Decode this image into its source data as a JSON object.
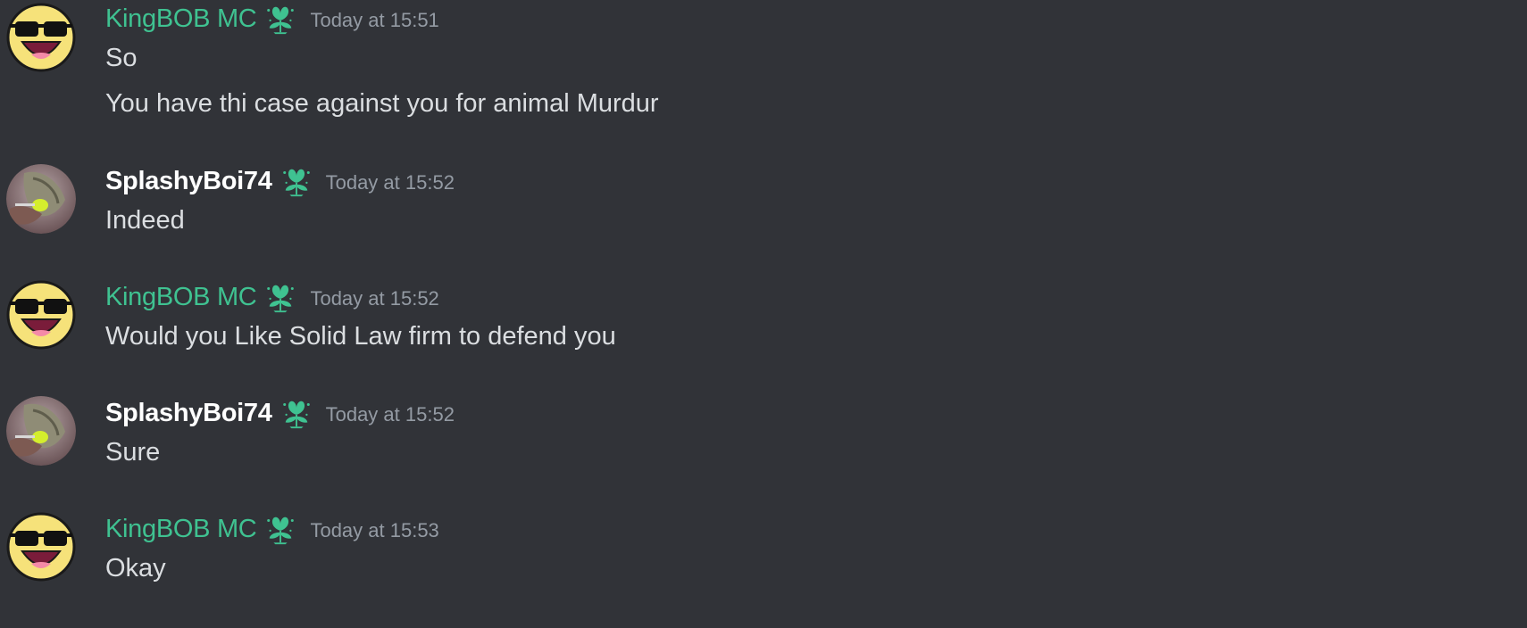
{
  "messages": [
    {
      "author": "KingBOB MC",
      "timestamp": "Today at 15:51",
      "lines": [
        "So",
        "You have thi case against you for animal Murdur"
      ]
    },
    {
      "author": "SplashyBoi74",
      "timestamp": "Today at 15:52",
      "lines": [
        "Indeed"
      ]
    },
    {
      "author": "KingBOB MC",
      "timestamp": "Today at 15:52",
      "lines": [
        "Would you Like Solid Law firm to defend you"
      ]
    },
    {
      "author": "SplashyBoi74",
      "timestamp": "Today at 15:52",
      "lines": [
        "Sure"
      ]
    },
    {
      "author": "KingBOB MC",
      "timestamp": "Today at 15:53",
      "lines": [
        "Okay"
      ]
    }
  ],
  "colors": {
    "background": "#313338",
    "kingbob_name": "#3fc291",
    "splashy_name": "#ffffff",
    "timestamp": "#949ba4",
    "message_text": "#dbdee1",
    "badge": "#3fc291"
  },
  "icons": {
    "badge": "green-flower-badge-icon",
    "kingbob_avatar": "sunglasses-smiley-avatar",
    "splashy_avatar": "photo-avatar"
  }
}
